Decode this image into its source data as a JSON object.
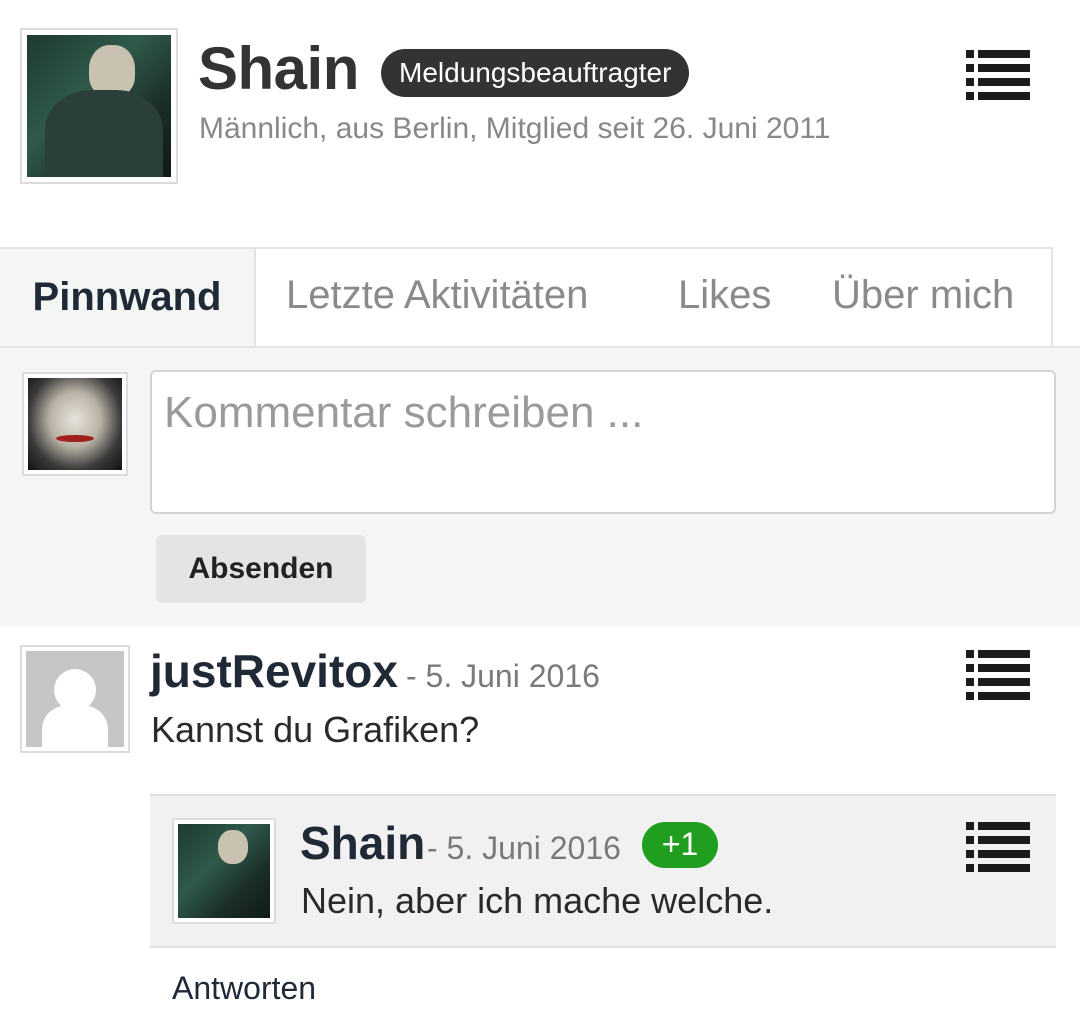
{
  "profile": {
    "username": "Shain",
    "role_badge": "Meldungsbeauftragter",
    "meta": "Männlich, aus Berlin, Mitglied seit 26. Juni 2011"
  },
  "tabs": [
    {
      "label": "Pinnwand",
      "active": true
    },
    {
      "label": "Letzte Aktivitäten",
      "active": false
    },
    {
      "label": "Likes",
      "active": false
    },
    {
      "label": "Über mich",
      "active": false
    }
  ],
  "composer": {
    "placeholder": "Kommentar schreiben ...",
    "submit_label": "Absenden"
  },
  "posts": [
    {
      "author": "justRevitox",
      "date": "- 5. Juni 2016",
      "text": "Kannst du Grafiken?",
      "reply": {
        "author": "Shain",
        "date": "- 5. Juni 2016",
        "likes": "+1",
        "text": "Nein, aber ich mache welche."
      },
      "reply_link_label": "Antworten"
    }
  ],
  "icons": {
    "menu": "list-menu-icon"
  }
}
